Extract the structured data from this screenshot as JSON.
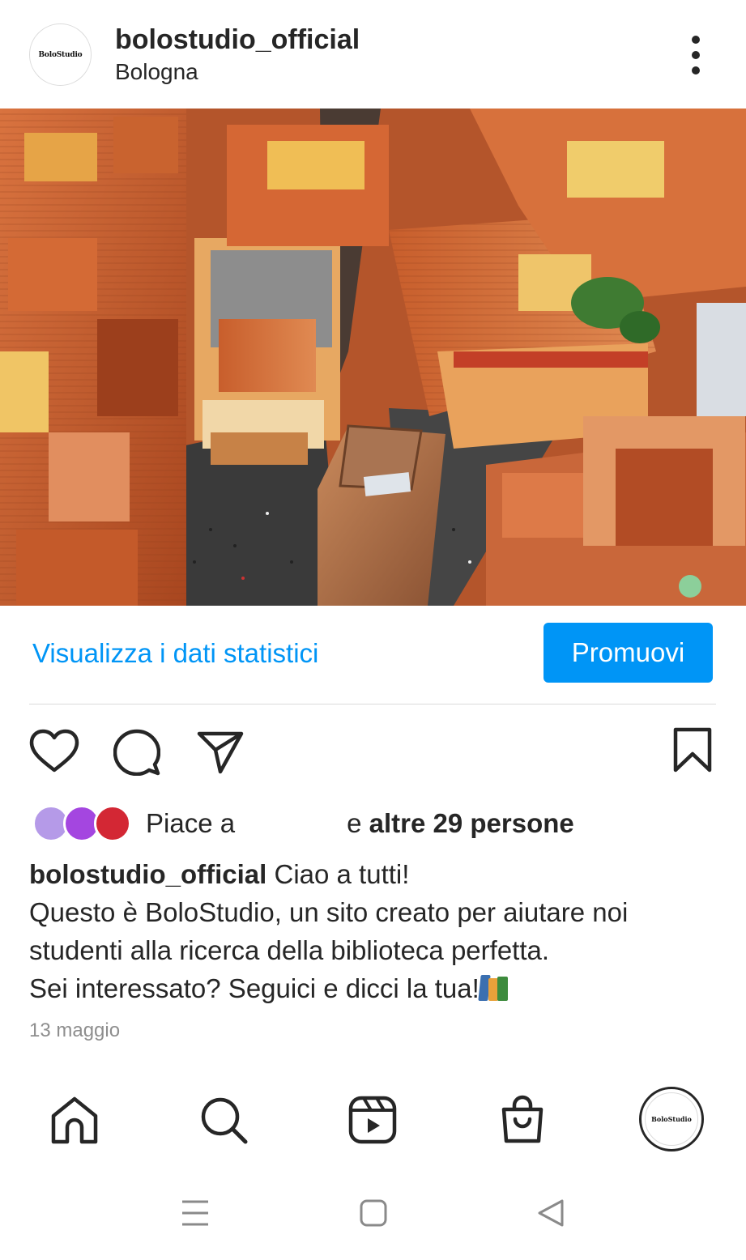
{
  "post": {
    "username": "bolostudio_official",
    "location": "Bologna",
    "avatar_text": "BoloStudio",
    "photo_alt": "",
    "view_insights": "Visualizza i dati statistici",
    "promote": "Promuovi",
    "likes_prefix": "Piace a",
    "likes_connector": "e",
    "likes_others": "altre 29 persone",
    "caption_user": "bolostudio_official",
    "caption_line1": "Ciao a tutti!",
    "caption_line2": "Questo è BoloStudio, un sito creato per aiutare noi",
    "caption_line3": "studenti alla ricerca della biblioteca perfetta.",
    "caption_line4": "Sei interessato? Seguici e dicci la tua!",
    "date": "13 maggio"
  },
  "actions": {
    "like_icon": "heart-icon",
    "comment_icon": "comment-icon",
    "share_icon": "paper-plane-icon",
    "save_icon": "bookmark-icon"
  },
  "nav": {
    "items": [
      "home-icon",
      "search-icon",
      "reels-icon",
      "shop-icon",
      "profile-avatar"
    ],
    "profile_text": "BoloStudio"
  },
  "system_nav": [
    "menu-icon",
    "home-square-icon",
    "back-triangle-icon"
  ],
  "colors": {
    "accent": "#0095f6",
    "text": "#262626",
    "muted": "#8e8e8e",
    "divider": "#dbdbdb"
  }
}
